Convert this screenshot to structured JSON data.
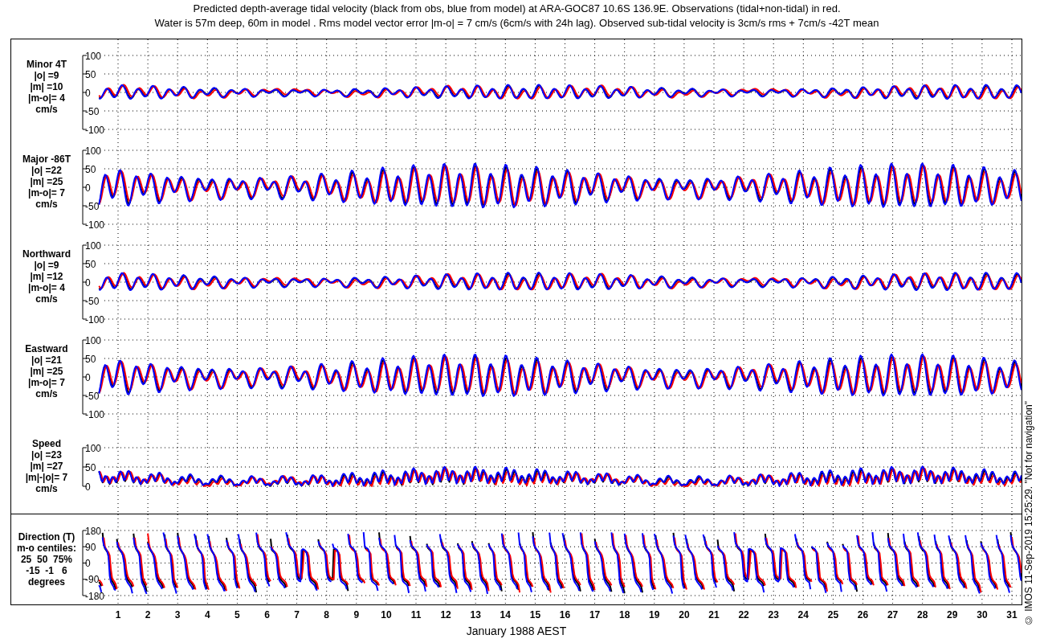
{
  "title_lines": [
    "Predicted depth-average tidal velocity (black from obs, blue from model) at ARA-GOC87 10.6S 136.9E. Observations (tidal+non-tidal) in red.",
    "Water is 57m deep, 60m in model . Rms model vector error |m-o| = 7 cm/s (6cm/s with 24h lag). Observed sub-tidal velocity is 3cm/s rms + 7cm/s -42T mean"
  ],
  "panels": [
    {
      "kind": "minor",
      "label_lines": [
        "Minor 4T",
        "|o| =9",
        "|m| =10",
        "|m-o|= 4",
        "cm/s"
      ],
      "yticks": [
        "100",
        "50",
        "0",
        "-50",
        "-100"
      ]
    },
    {
      "kind": "major",
      "label_lines": [
        "Major -86T",
        "|o| =22",
        "|m| =25",
        "|m-o|= 7",
        "cm/s"
      ],
      "yticks": [
        "100",
        "50",
        "0",
        "-50",
        "-100"
      ]
    },
    {
      "kind": "north",
      "label_lines": [
        "Northward",
        "|o| =9",
        "|m| =12",
        "|m-o|= 4",
        "cm/s"
      ],
      "yticks": [
        "100",
        "50",
        "0",
        "-50",
        "-100"
      ]
    },
    {
      "kind": "east",
      "label_lines": [
        "Eastward",
        "|o| =21",
        "|m| =25",
        "|m-o|= 7",
        "cm/s"
      ],
      "yticks": [
        "100",
        "50",
        "0",
        "-50",
        "-100"
      ]
    },
    {
      "kind": "speed",
      "label_lines": [
        "Speed",
        "|o| =23",
        "|m| =27",
        "|m|-|o|= 7",
        "cm/s"
      ],
      "yticks": [
        "100",
        "50",
        "0"
      ]
    },
    {
      "kind": "direction",
      "label_lines": [
        "Direction (T)",
        "m-o centiles:",
        "25  50  75%",
        "-15  -1   6",
        "degrees"
      ],
      "yticks": [
        "180",
        "90",
        "0",
        "-90",
        "-180"
      ]
    }
  ],
  "x_axis": {
    "day_labels": [
      "1",
      "2",
      "3",
      "4",
      "5",
      "6",
      "7",
      "8",
      "9",
      "10",
      "11",
      "12",
      "13",
      "14",
      "15",
      "16",
      "17",
      "18",
      "19",
      "20",
      "21",
      "22",
      "23",
      "24",
      "25",
      "26",
      "27",
      "28",
      "29",
      "30",
      "31"
    ],
    "label": "January 1988 AEST"
  },
  "credit": "© IMOS 11-Sep-2019 15:25:29. \"Not for navigation\""
}
